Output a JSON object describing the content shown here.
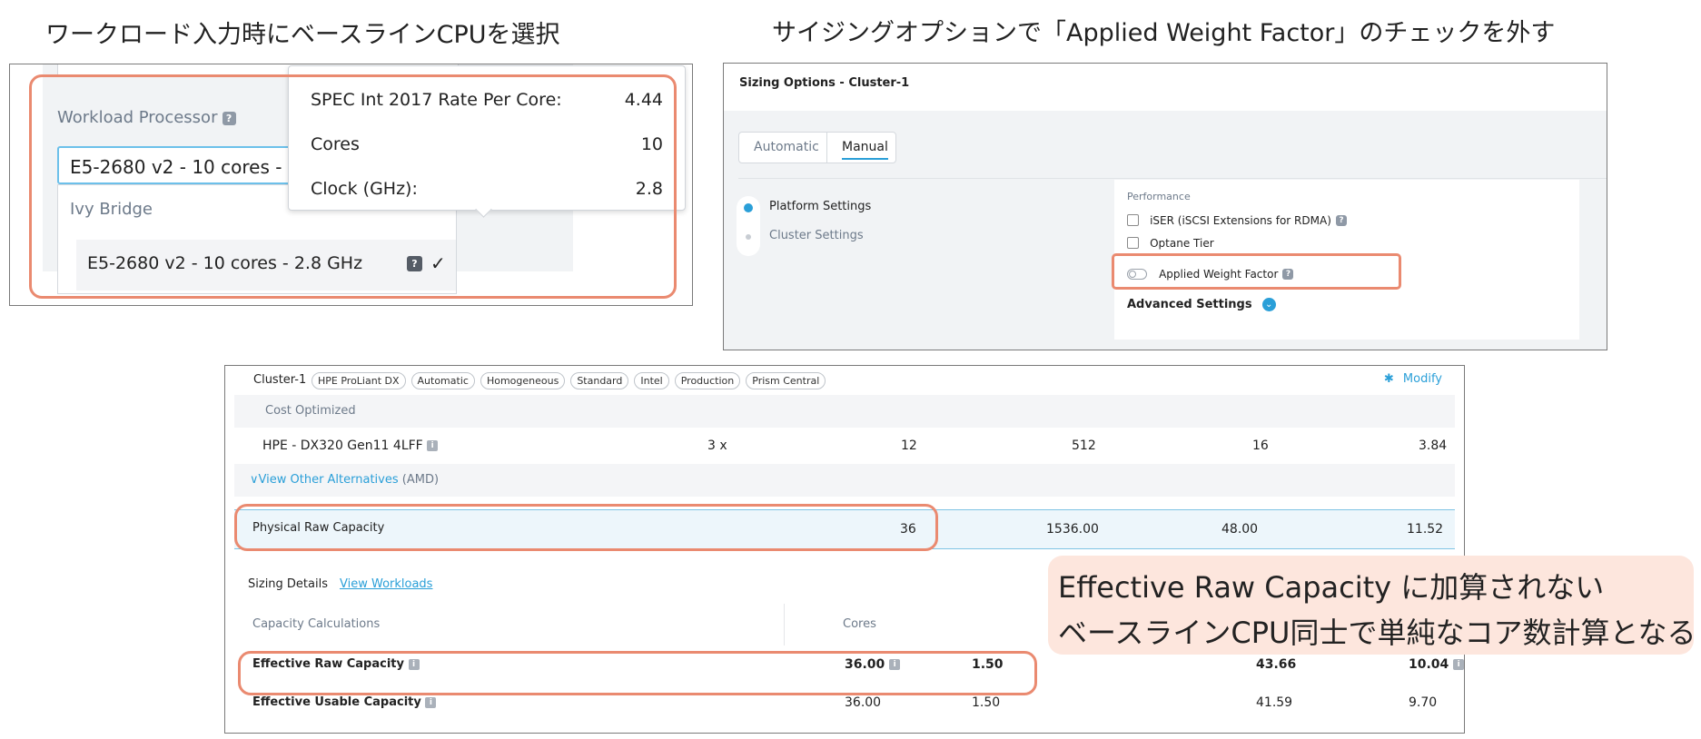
{
  "headings": {
    "left": "ワークロード入力時にベースラインCPUを選択",
    "right": "サイジングオプションで「Applied Weight Factor」のチェックを外す"
  },
  "panel1": {
    "workload_processor_label": "Workload Processor",
    "selected_value": "E5-2680 v2 - 10 cores - 2.8",
    "group_label": "Ivy Bridge",
    "option_label": "E5-2680 v2 - 10 cores - 2.8 GHz",
    "tooltip": {
      "rows": [
        {
          "label": "SPEC Int 2017 Rate Per Core:",
          "value": "4.44"
        },
        {
          "label": "Cores",
          "value": "10"
        },
        {
          "label": "Clock (GHz):",
          "value": "2.8"
        }
      ]
    },
    "help_glyph": "?",
    "check_glyph": "✓"
  },
  "panel2": {
    "title": "Sizing Options - Cluster-1",
    "tabs": [
      "Automatic",
      "Manual"
    ],
    "active_tab": "Manual",
    "nav": [
      "Platform Settings",
      "Cluster Settings"
    ],
    "section_label": "Performance",
    "options": [
      "iSER (iSCSI Extensions for RDMA)",
      "Optane Tier"
    ],
    "toggle_label": "Applied Weight Factor",
    "advanced_label": "Advanced Settings",
    "help_glyph": "?"
  },
  "panel3": {
    "cluster_name": "Cluster-1",
    "tags": [
      "HPE ProLiant DX",
      "Automatic",
      "Homogeneous",
      "Standard",
      "Intel",
      "Production",
      "Prism Central"
    ],
    "modify_label": "Modify",
    "cost_optimized": "Cost Optimized",
    "model_row": {
      "name": "HPE - DX320 Gen11 4LFF",
      "values": [
        "3 x",
        "12",
        "512",
        "16",
        "3.84"
      ]
    },
    "view_alternatives": "View Other Alternatives",
    "alternatives_suffix": "(AMD)",
    "physical_row": {
      "name": "Physical Raw Capacity",
      "values": [
        "36",
        "1536.00",
        "48.00",
        "11.52"
      ]
    },
    "sizing_details": "Sizing Details",
    "view_workloads": "View Workloads",
    "capacity_calc": "Capacity Calculations",
    "cores_header": "Cores",
    "effective_raw": {
      "name": "Effective Raw Capacity",
      "values": [
        "36.00",
        "1.50",
        "43.66",
        "10.04"
      ]
    },
    "effective_usable": {
      "name": "Effective Usable Capacity",
      "values": [
        "36.00",
        "1.50",
        "41.59",
        "9.70"
      ]
    },
    "info_glyph": "i"
  },
  "callout": {
    "line1": "Effective Raw Capacity に加算されない",
    "line2": "ベースラインCPU同士で単純なコア数計算となる"
  },
  "colors": {
    "highlight": "#ea8a70",
    "callout_bg": "#fde6dd",
    "accent": "#2a9fd8"
  }
}
